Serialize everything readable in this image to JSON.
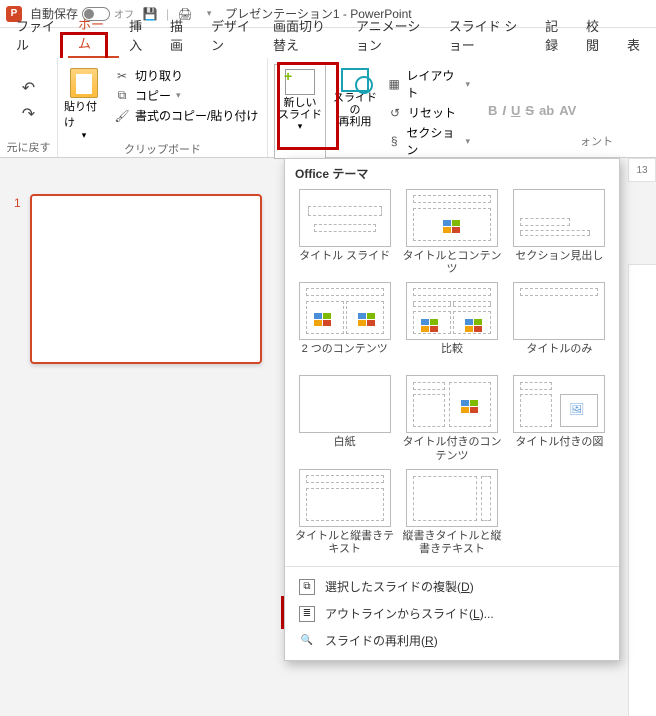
{
  "titlebar": {
    "autosave_label": "自動保存",
    "autosave_state": "オフ",
    "doc_title": "プレゼンテーション1 - PowerPoint"
  },
  "tabs": {
    "file": "ファイル",
    "home": "ホーム",
    "insert": "挿入",
    "draw": "描画",
    "design": "デザイン",
    "transitions": "画面切り替え",
    "animations": "アニメーション",
    "slideshow": "スライド ショー",
    "record": "記録",
    "review": "校閲",
    "view": "表"
  },
  "ribbon": {
    "undo_group": "元に戻す",
    "paste": "貼り付け",
    "cut": "切り取り",
    "copy": "コピー",
    "format_painter": "書式のコピー/貼り付け",
    "clipboard_group": "クリップボード",
    "new_slide": "新しい\nスライド",
    "reuse_slides": "スライドの\n再利用",
    "layout": "レイアウト",
    "reset": "リセット",
    "section": "セクション",
    "font_partial": "ォント"
  },
  "gallery": {
    "header": "Office テーマ",
    "layouts": [
      "タイトル スライド",
      "タイトルとコンテンツ",
      "セクション見出し",
      "2 つのコンテンツ",
      "比較",
      "タイトルのみ",
      "白紙",
      "タイトル付きのコンテンツ",
      "タイトル付きの図",
      "タイトルと縦書きテキスト",
      "縦書きタイトルと縦書きテキスト"
    ],
    "duplicate": "選択したスライドの複製",
    "duplicate_key": "D",
    "outline": "アウトラインからスライド",
    "outline_key": "L",
    "outline_suffix": "...",
    "reuse": "スライドの再利用",
    "reuse_key": "R"
  },
  "workspace": {
    "slide_number": "1",
    "ruler_value": "13"
  }
}
